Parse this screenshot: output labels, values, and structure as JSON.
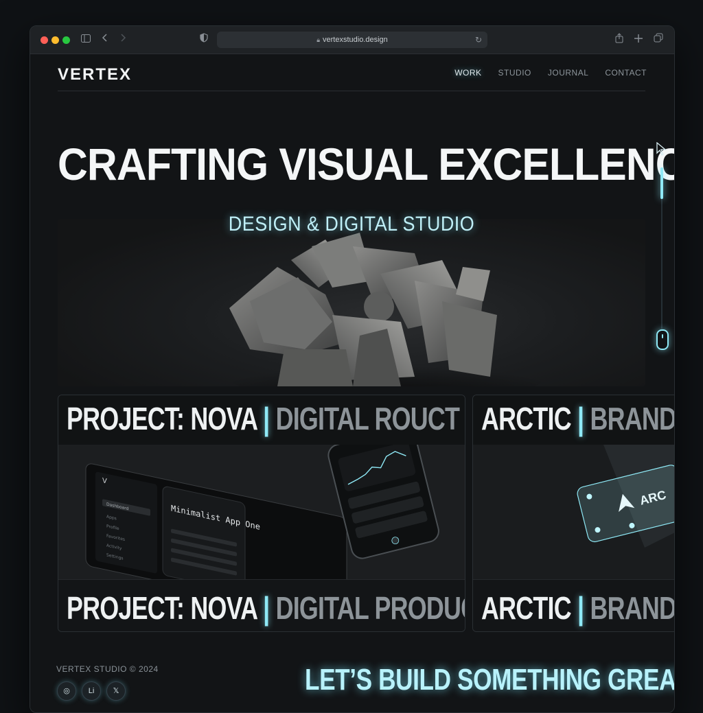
{
  "browser": {
    "url": "vertexstudio.design",
    "icons": {
      "sidebar": "sidebar-icon",
      "back": "chevron-left-icon",
      "forward": "chevron-right-icon",
      "shield": "shield-icon",
      "lock": "lock-icon",
      "reload": "reload-icon",
      "share": "share-icon",
      "new_tab": "plus-icon",
      "tabs": "tabs-icon"
    }
  },
  "site": {
    "logo": "VERTEX",
    "nav": [
      {
        "label": "WORK",
        "active": true
      },
      {
        "label": "STUDIO",
        "active": false
      },
      {
        "label": "JOURNAL",
        "active": false
      },
      {
        "label": "CONTACT",
        "active": false
      }
    ]
  },
  "hero": {
    "headline": "CRAFTING VISUAL EXCELLENCE",
    "subheadline": "DESIGN & DIGITAL STUDIO"
  },
  "projects": [
    {
      "name": "PROJECT: NOVA",
      "category_header": "DIGITAL ROUCT",
      "category": "DIGITAL PRODUCT",
      "mockup": {
        "app_title": "Minimalist App One",
        "menu": [
          "Dashboard",
          "Apps",
          "Profile",
          "Favorites",
          "Activity",
          "Settings"
        ]
      }
    },
    {
      "name": "ARCTIC",
      "category_header": "BRANDING",
      "category": "BRANDING",
      "mockup": {
        "brand_text": "ARC"
      }
    }
  ],
  "footer": {
    "copyright": "VERTEX STUDIO © 2024",
    "social": [
      {
        "name": "instagram-icon",
        "label": "◎"
      },
      {
        "name": "linkedin-icon",
        "label": "Li"
      },
      {
        "name": "x-icon",
        "label": "𝕏"
      }
    ],
    "cta": "LET’S BUILD SOMETHING GREAT"
  },
  "colors": {
    "accent": "#8fe9f6",
    "background": "#121416",
    "text": "#f2f4f5",
    "muted": "#8d9499"
  }
}
